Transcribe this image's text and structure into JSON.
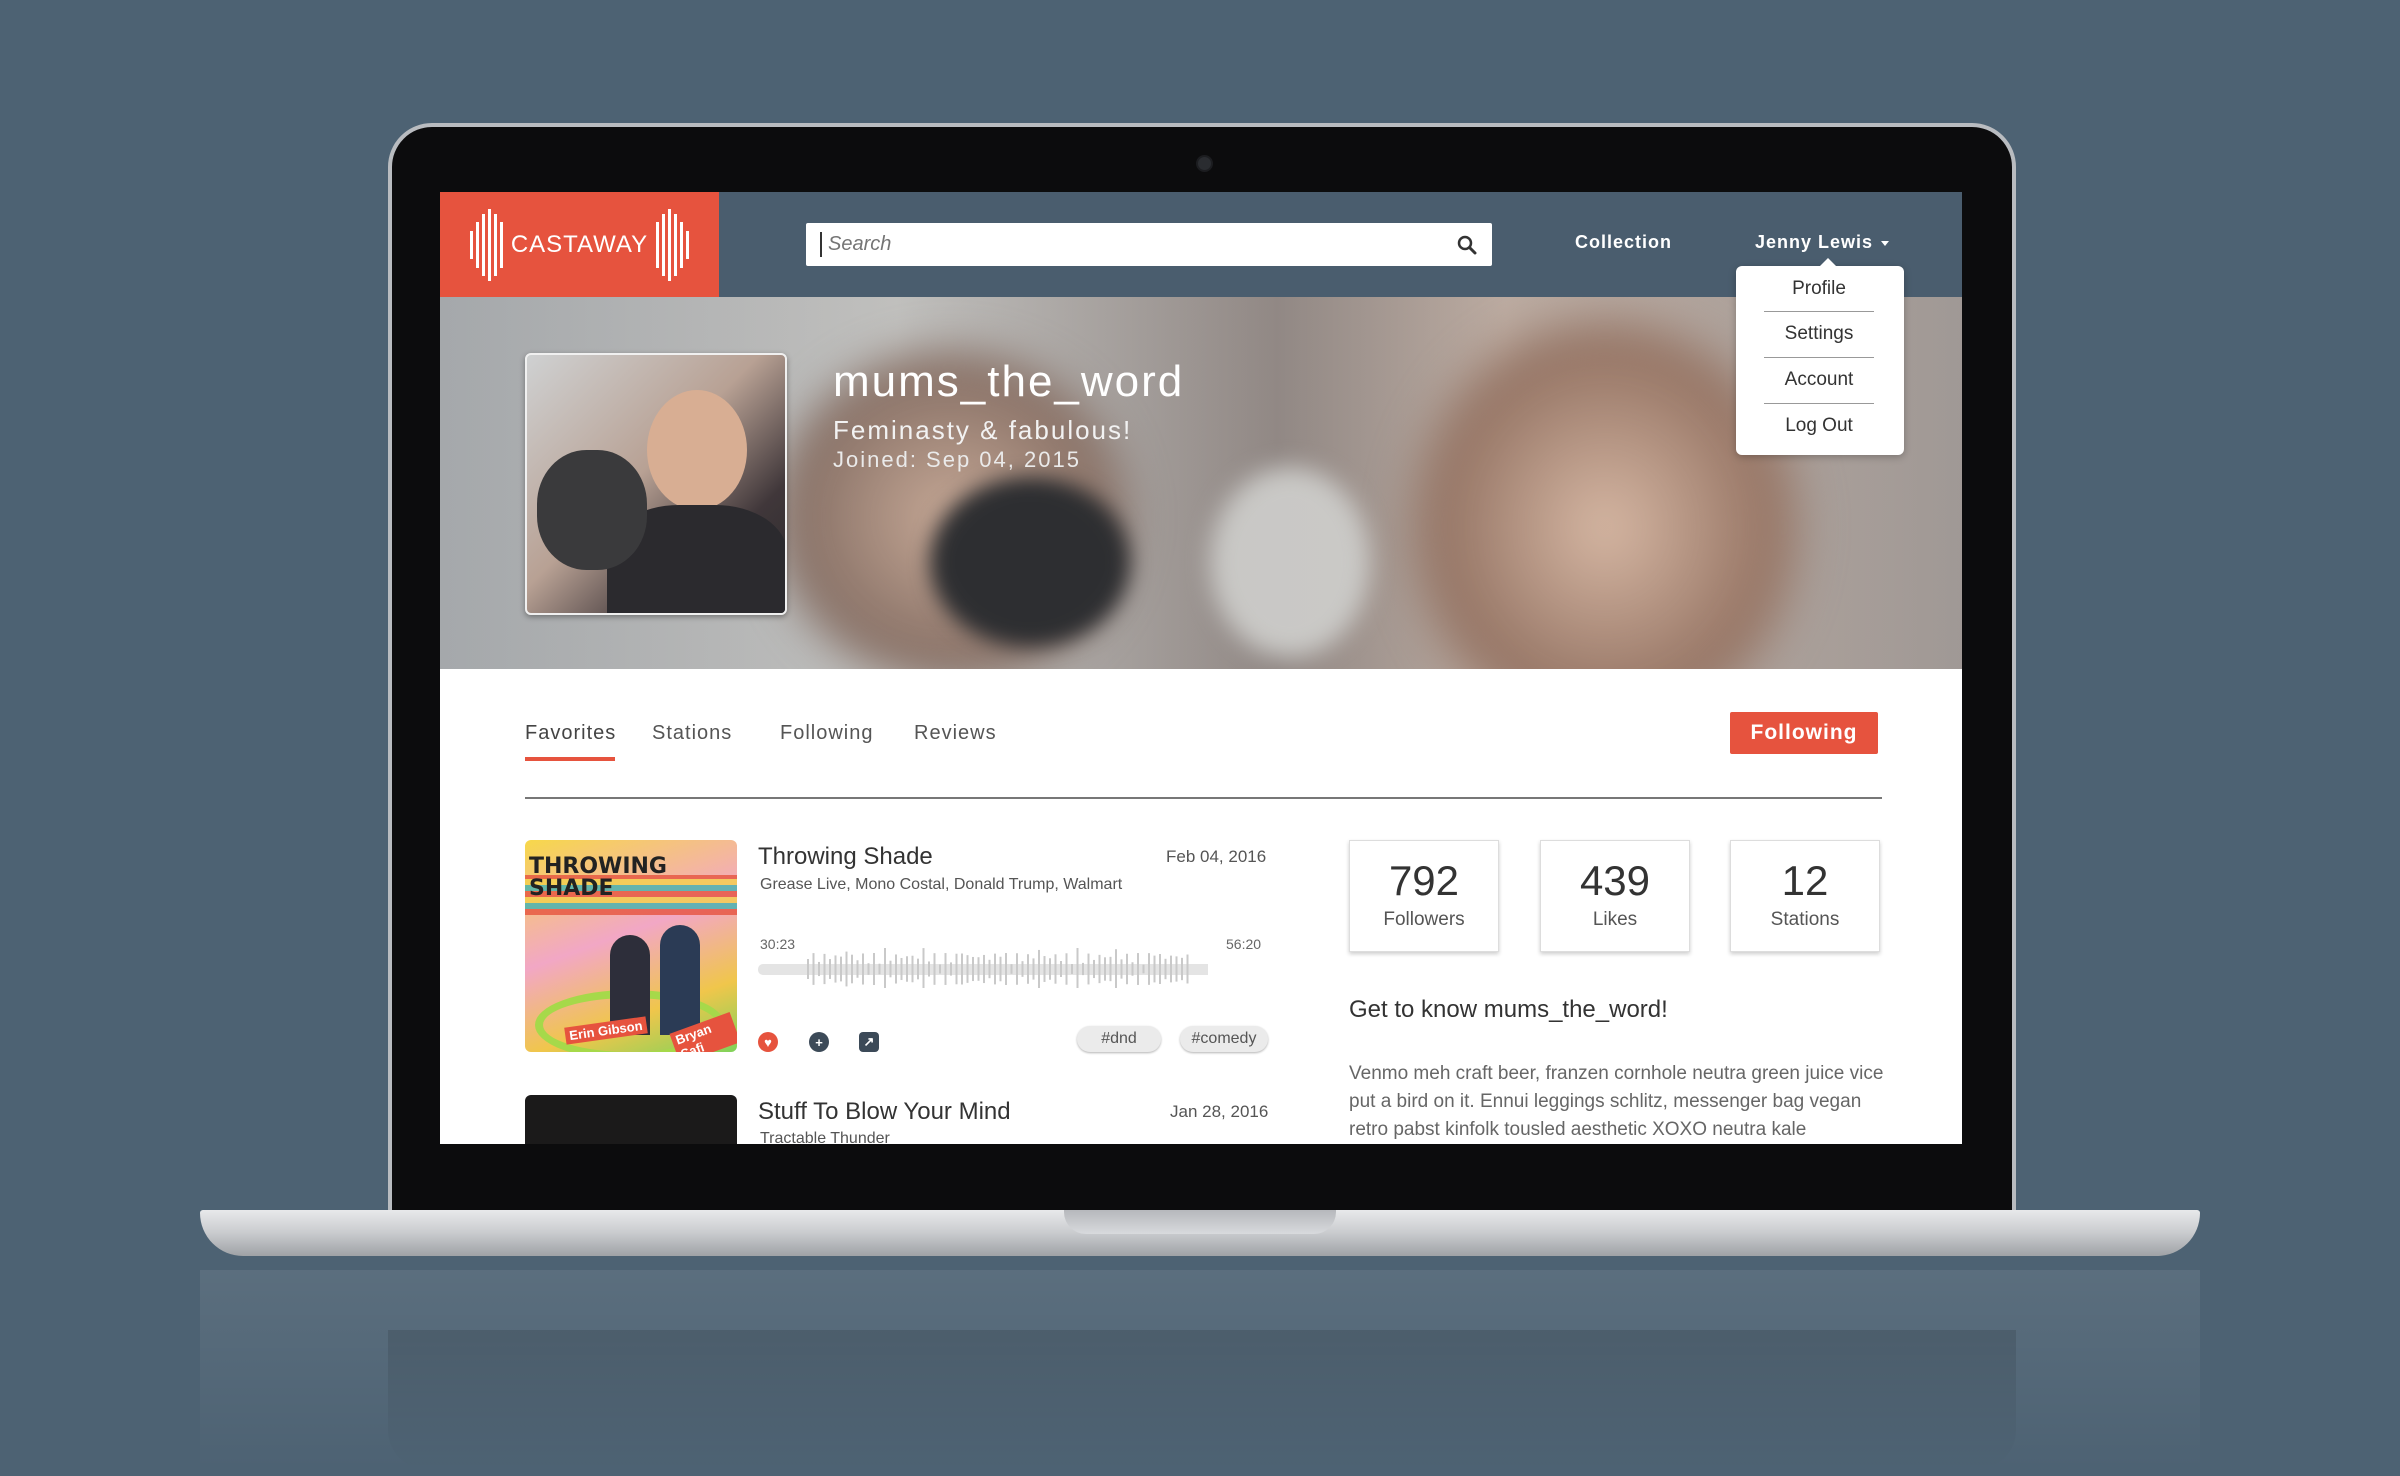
{
  "app": {
    "logo_text": "CASTAWAY",
    "accent_color": "#e6533e",
    "topbar_color": "#4a5d6e"
  },
  "search": {
    "placeholder": "Search",
    "icon": "search-icon"
  },
  "nav": {
    "collection": "Collection",
    "user": "Jenny Lewis"
  },
  "user_menu": {
    "items": [
      "Profile",
      "Settings",
      "Account",
      "Log Out"
    ]
  },
  "profile": {
    "username": "mums_the_word",
    "tagline": "Feminasty & fabulous!",
    "joined": "Joined: Sep 04, 2015"
  },
  "tabs": [
    "Favorites",
    "Stations",
    "Following",
    "Reviews"
  ],
  "active_tab": "Favorites",
  "follow_button": "Following",
  "episodes": [
    {
      "title": "Throwing Shade",
      "tags_line": "Grease Live, Mono Costal, Donald Trump, Walmart",
      "date": "Feb 04, 2016",
      "time_current": "30:23",
      "time_total": "56:20",
      "art_title": "THROWING SHADE",
      "art_names": [
        "Erin Gibson",
        "Bryan Safi"
      ],
      "tags": [
        "#dnd",
        "#comedy"
      ],
      "actions": [
        "heart-icon",
        "add-icon",
        "share-icon"
      ]
    },
    {
      "title": "Stuff To Blow Your Mind",
      "tags_line": "Tractable Thunder",
      "date": "Jan 28, 2016"
    }
  ],
  "stats": [
    {
      "value": "792",
      "label": "Followers"
    },
    {
      "value": "439",
      "label": "Likes"
    },
    {
      "value": "12",
      "label": "Stations"
    }
  ],
  "about": {
    "heading": "Get to know mums_the_word!",
    "text": "Venmo meh craft beer, franzen cornhole neutra green juice vice put a bird on it. Ennui leggings schlitz, messenger bag vegan retro pabst kinfolk tousled aesthetic XOXO neutra kale"
  }
}
